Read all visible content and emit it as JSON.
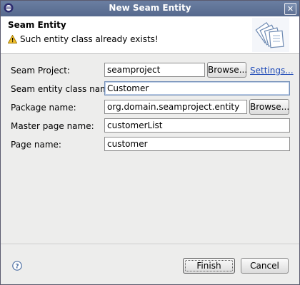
{
  "window": {
    "title": "New Seam Entity"
  },
  "banner": {
    "heading": "Seam Entity",
    "message": "Such entity class already exists!"
  },
  "form": {
    "project": {
      "label": "Seam Project:",
      "value": "seamproject",
      "browse_label": "Browse...",
      "settings_label": "Settings..."
    },
    "entity_class": {
      "label": "Seam entity class name:",
      "value": "Customer"
    },
    "package": {
      "label": "Package name:",
      "value": "org.domain.seamproject.entity",
      "browse_label": "Browse..."
    },
    "master_page": {
      "label": "Master page name:",
      "value": "customerList"
    },
    "page": {
      "label": "Page name:",
      "value": "customer"
    }
  },
  "footer": {
    "finish_label": "Finish",
    "cancel_label": "Cancel"
  },
  "icons": {
    "app": "eclipse-icon",
    "warning": "warning-icon",
    "help": "help-icon",
    "close": "close-icon",
    "wizard": "wizard-image"
  },
  "colors": {
    "titlebar": "#5f7396",
    "link": "#1f4bb8",
    "warning": "#f2c12e"
  }
}
